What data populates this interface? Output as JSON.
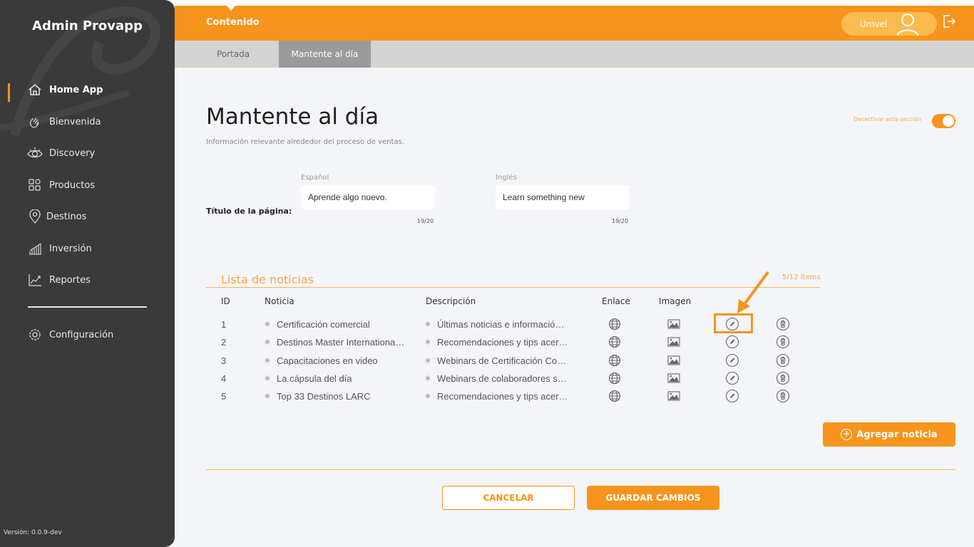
{
  "sidebar": {
    "title": "Admin Provapp",
    "items": [
      {
        "label": "Home App",
        "icon": "home-icon"
      },
      {
        "label": "Bienvenida",
        "icon": "wave-hand-icon"
      },
      {
        "label": "Discovery",
        "icon": "eye-icon"
      },
      {
        "label": "Productos",
        "icon": "grid-icon"
      },
      {
        "label": "Destinos",
        "icon": "map-pin-icon"
      },
      {
        "label": "Inversión",
        "icon": "bar-chart-icon"
      },
      {
        "label": "Reportes",
        "icon": "line-chart-icon"
      }
    ],
    "settings": {
      "label": "Configuración",
      "icon": "gear-icon"
    },
    "version": "Versión: 0.0.9-dev"
  },
  "header": {
    "title": "Contenido",
    "user_name": "Umvel"
  },
  "tabs": [
    {
      "label": "Portada",
      "active": false
    },
    {
      "label": "Mantente al día",
      "active": true
    }
  ],
  "page": {
    "title": "Mantente al día",
    "subtitle": "Información relevante alrededor del proceso de ventas.",
    "toggle_label": "Desactivar esta sección",
    "toggle_on": true
  },
  "page_title_field": {
    "row_label": "Título de la página:",
    "spanish": {
      "label": "Español",
      "value": "Aprende algo nuevo.",
      "counter": "19/20"
    },
    "english": {
      "label": "Inglés",
      "value": "Learn something new",
      "counter": "19/20"
    }
  },
  "news_list": {
    "title": "Lista de noticias",
    "count": "5/12 ítems",
    "headers": {
      "id": "ID",
      "news": "Noticia",
      "description": "Descripción",
      "link": "Enlace",
      "image": "Imagen"
    },
    "rows": [
      {
        "id": "1",
        "news": "Certificación comercial",
        "description": "Últimas noticias e información de tu pr..."
      },
      {
        "id": "2",
        "news": "Destinos Master International Collection",
        "description": "Recomendaciones y tips acerca de los d..."
      },
      {
        "id": "3",
        "news": "Capacitaciones en video",
        "description": "Webinars de Certificación Comercial"
      },
      {
        "id": "4",
        "news": "La cápsula del día",
        "description": "Webinars de colaboradores sobre destinos"
      },
      {
        "id": "5",
        "news": "Top 33 Destinos LARC",
        "description": "Recomendaciones y tips acerca de los d..."
      }
    ]
  },
  "actions": {
    "add_news": "Agregar noticia",
    "cancel": "CANCELAR",
    "save": "GUARDAR CAMBIOS"
  },
  "colors": {
    "accent": "#f7941d",
    "sidebar": "#3a3a3a",
    "background": "#f4f5f9"
  }
}
